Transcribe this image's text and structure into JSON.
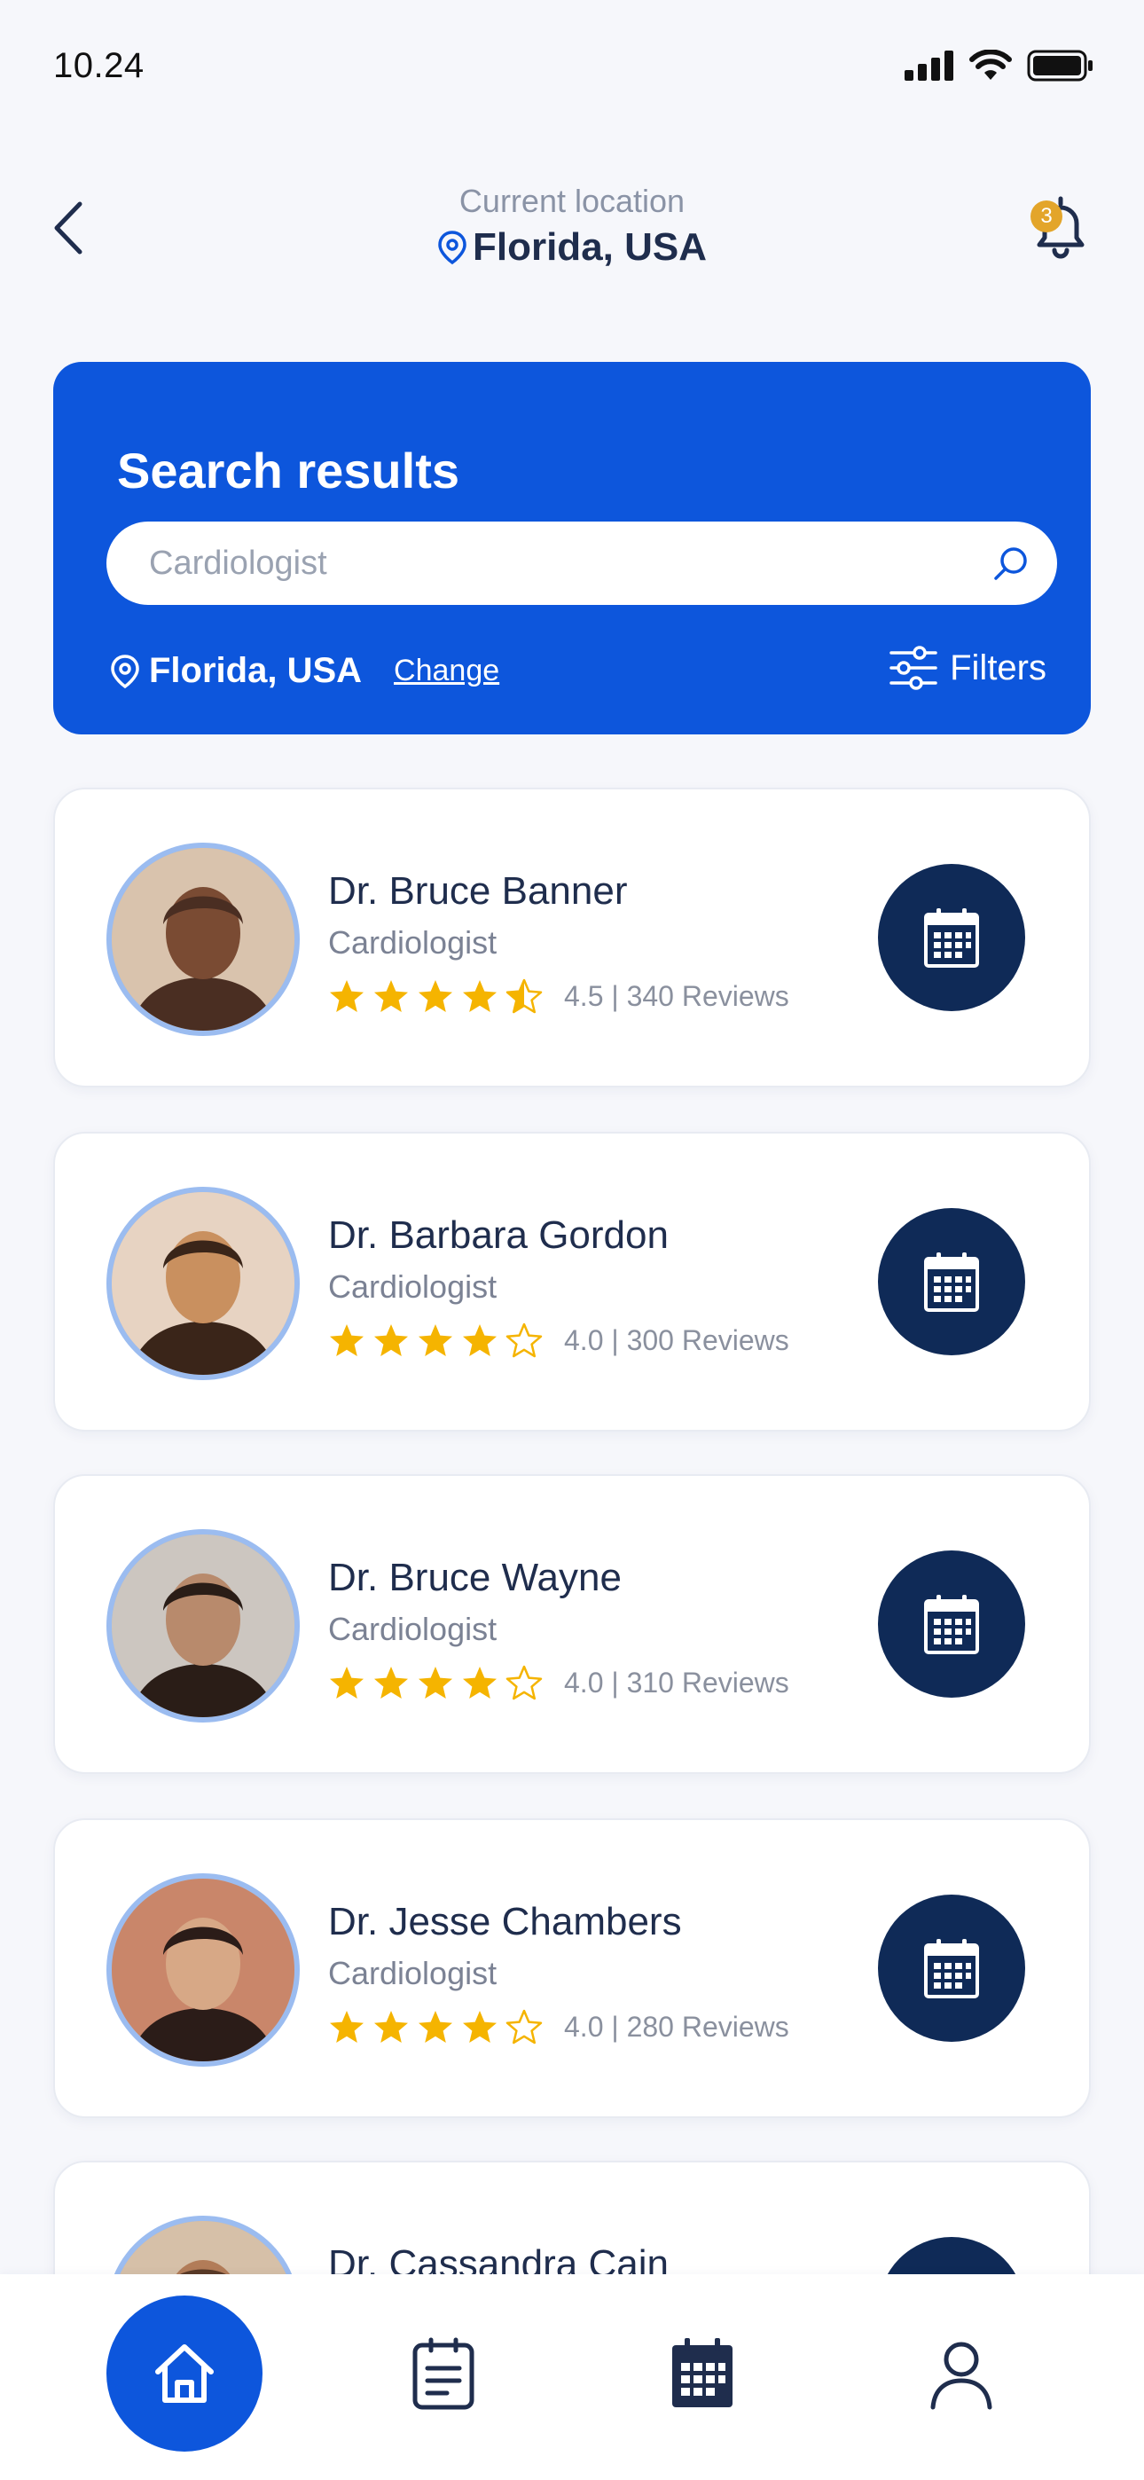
{
  "status_bar": {
    "time": "10.24"
  },
  "header": {
    "location_label": "Current location",
    "location_value": "Florida, USA",
    "notification_count": "3"
  },
  "search": {
    "title": "Search results",
    "placeholder": "Cardiologist",
    "location": "Florida, USA",
    "change_label": "Change",
    "filters_label": "Filters"
  },
  "doctors": [
    {
      "name": "Dr. Bruce Banner",
      "specialty": "Cardiologist",
      "rating": 4.5,
      "rating_text": "4.5 | 340 Reviews"
    },
    {
      "name": "Dr. Barbara Gordon",
      "specialty": "Cardiologist",
      "rating": 4.0,
      "rating_text": "4.0 | 300 Reviews"
    },
    {
      "name": "Dr. Bruce Wayne",
      "specialty": "Cardiologist",
      "rating": 4.0,
      "rating_text": "4.0 | 310 Reviews"
    },
    {
      "name": "Dr. Jesse Chambers",
      "specialty": "Cardiologist",
      "rating": 4.0,
      "rating_text": "4.0 | 280 Reviews"
    },
    {
      "name": "Dr. Cassandra Cain"
    }
  ],
  "bottom_nav": [
    {
      "icon": "home-icon",
      "active": true
    },
    {
      "icon": "clipboard-icon",
      "active": false
    },
    {
      "icon": "calendar-icon",
      "active": false
    },
    {
      "icon": "profile-icon",
      "active": false
    }
  ],
  "colors": {
    "primary": "#0d56dc",
    "navy": "#0f2a57",
    "star": "#f5b400",
    "badge": "#e3a52a",
    "background": "#f6f7fb"
  }
}
